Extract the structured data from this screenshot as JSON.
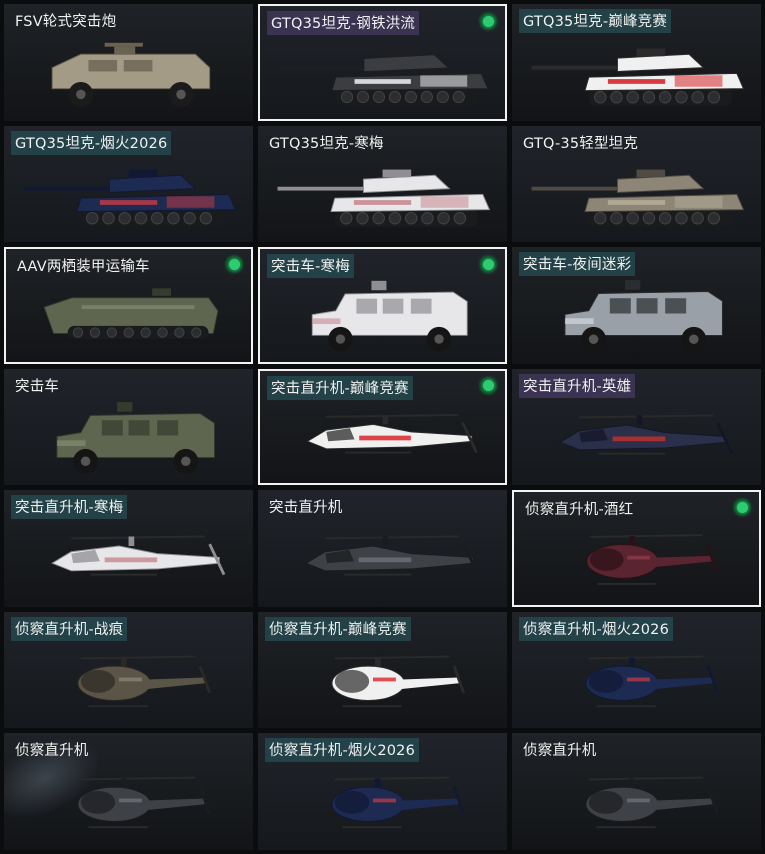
{
  "colors": {
    "selected_border": "#f2f2f2",
    "owned_dot": "#2ecc71",
    "tag_teal": "#264e54",
    "tag_purple": "#463a60"
  },
  "cards": [
    {
      "label": "FSV轮式突击炮",
      "kind": "armored-car",
      "tag": "none",
      "selected": false,
      "owned": false,
      "paint": "sand"
    },
    {
      "label": "GTQ35坦克-钢铁洪流",
      "kind": "tank",
      "tag": "purple",
      "selected": true,
      "owned": true,
      "paint": "steel"
    },
    {
      "label": "GTQ35坦克-巅峰竞赛",
      "kind": "tank",
      "tag": "teal",
      "selected": false,
      "owned": false,
      "paint": "racing"
    },
    {
      "label": "GTQ35坦克-烟火2026",
      "kind": "tank",
      "tag": "teal",
      "selected": false,
      "owned": false,
      "paint": "fireworks"
    },
    {
      "label": "GTQ35坦克-寒梅",
      "kind": "tank",
      "tag": "none",
      "selected": false,
      "owned": false,
      "paint": "plum"
    },
    {
      "label": "GTQ-35轻型坦克",
      "kind": "tank",
      "tag": "none",
      "selected": false,
      "owned": false,
      "paint": "desert"
    },
    {
      "label": "AAV两栖装甲运输车",
      "kind": "amphibious",
      "tag": "none",
      "selected": true,
      "owned": true,
      "paint": "olive"
    },
    {
      "label": "突击车-寒梅",
      "kind": "assault-truck",
      "tag": "teal",
      "selected": true,
      "owned": true,
      "paint": "plum"
    },
    {
      "label": "突击车-夜间迷彩",
      "kind": "assault-truck",
      "tag": "teal",
      "selected": false,
      "owned": false,
      "paint": "nightcamo"
    },
    {
      "label": "突击车",
      "kind": "assault-truck",
      "tag": "none",
      "selected": false,
      "owned": false,
      "paint": "olive"
    },
    {
      "label": "突击直升机-巅峰竞赛",
      "kind": "attack-heli",
      "tag": "teal",
      "selected": true,
      "owned": true,
      "paint": "racing"
    },
    {
      "label": "突击直升机-英雄",
      "kind": "attack-heli",
      "tag": "purple",
      "selected": false,
      "owned": false,
      "paint": "hero"
    },
    {
      "label": "突击直升机-寒梅",
      "kind": "attack-heli",
      "tag": "teal",
      "selected": false,
      "owned": false,
      "paint": "plum"
    },
    {
      "label": "突击直升机",
      "kind": "attack-heli",
      "tag": "none",
      "selected": false,
      "owned": false,
      "paint": "dark"
    },
    {
      "label": "侦察直升机-酒红",
      "kind": "scout-heli",
      "tag": "none",
      "selected": true,
      "owned": true,
      "paint": "wine"
    },
    {
      "label": "侦察直升机-战痕",
      "kind": "scout-heli",
      "tag": "teal",
      "selected": false,
      "owned": false,
      "paint": "battle"
    },
    {
      "label": "侦察直升机-巅峰竞赛",
      "kind": "scout-heli",
      "tag": "teal",
      "selected": false,
      "owned": false,
      "paint": "racing"
    },
    {
      "label": "侦察直升机-烟火2026",
      "kind": "scout-heli",
      "tag": "teal",
      "selected": false,
      "owned": false,
      "paint": "fireworks"
    },
    {
      "label": "侦察直升机",
      "kind": "scout-heli",
      "tag": "none",
      "selected": false,
      "owned": false,
      "paint": "dark"
    },
    {
      "label": "侦察直升机-烟火2026",
      "kind": "scout-heli",
      "tag": "teal",
      "selected": false,
      "owned": false,
      "paint": "fireworks"
    },
    {
      "label": "侦察直升机",
      "kind": "scout-heli",
      "tag": "none",
      "selected": false,
      "owned": false,
      "paint": "dark"
    }
  ]
}
